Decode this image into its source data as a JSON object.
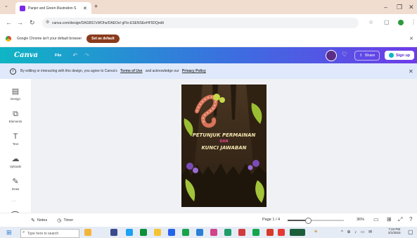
{
  "browser": {
    "tab_title": "Panjer and Green Illustration S",
    "tab_close": "✕",
    "new_tab": "+",
    "url": "canva.com/design/DAGBS7zWOhs/DAEOe/ gFlo-ESENSEeHF5DQedit",
    "window_controls": {
      "minimize": "–",
      "restore": "❐",
      "close": "✕"
    }
  },
  "infobar": {
    "message": "Google Chrome isn't your default browser",
    "button": "Set as default",
    "close": "✕"
  },
  "canva_header": {
    "logo": "Canva",
    "file": "File",
    "share": "Share",
    "signup": "Sign up"
  },
  "notice": {
    "prefix": "By editing or interacting with this design, you agree to Canva's",
    "terms": "Terms of Use",
    "middle": "and acknowledge our",
    "privacy": "Privacy Policy",
    "close": "✕"
  },
  "sidebar": {
    "items": [
      {
        "label": "Design",
        "icon": "▤"
      },
      {
        "label": "Elements",
        "icon": "⧉"
      },
      {
        "label": "Text",
        "icon": "T"
      },
      {
        "label": "Uploads",
        "icon": "☁"
      },
      {
        "label": "Draw",
        "icon": "✎"
      }
    ]
  },
  "poster": {
    "line1": "PETUNJUK PERMAINAN",
    "line2": "DAN",
    "line3": "KUNCI JAWABAN",
    "colors": {
      "title": "#f4e6b0",
      "accent": "#e6458b",
      "bg": "#3c2a1a"
    }
  },
  "bottom": {
    "notes": "Notes",
    "timer": "Timer",
    "page": "Page 1 / 4",
    "zoom": "36%",
    "zoom_level": 0.36
  },
  "taskbar": {
    "search": "Type here to search",
    "time": "7:24 PM",
    "date": "2/1/2023"
  }
}
